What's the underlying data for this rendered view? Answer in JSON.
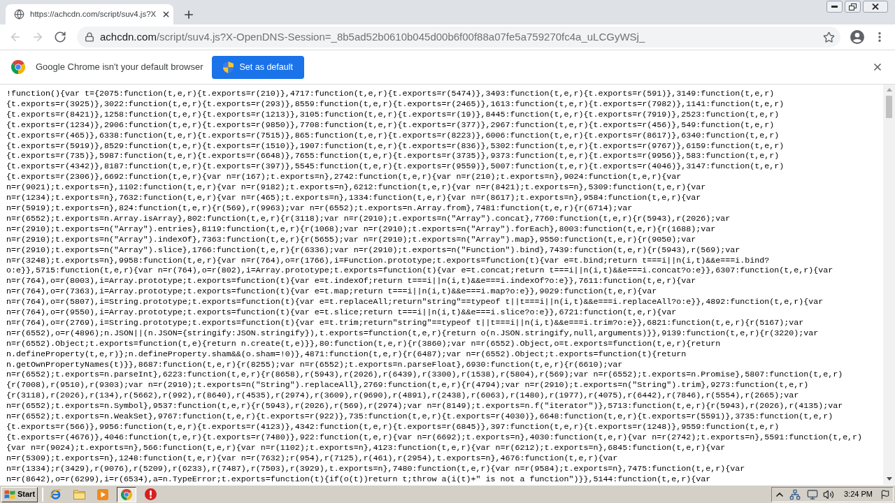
{
  "tabs": [
    {
      "title": "https://achcdn.com/script/suv4.js?X",
      "selected": true
    }
  ],
  "toolbar": {
    "nav": [
      {
        "kind": "back",
        "disabled": true
      },
      {
        "kind": "forward",
        "disabled": true
      },
      {
        "kind": "reload",
        "disabled": false
      }
    ],
    "url_host": "achcdn.com",
    "url_path": "/script/suv4.js?X-OpenDNS-Session=_8b5ad52b0610b045d00b6f00f88a07fe5a759270fc4a_uLCGyWSj_"
  },
  "infobar": {
    "message": "Google Chrome isn't your default browser",
    "button": "Set as default"
  },
  "document": {
    "lines": [
      "!function(){var t={2075:function(t,e,r){t.exports=r(210)},4717:function(t,e,r){t.exports=r(5474)},3493:function(t,e,r){t.exports=r(591)},3149:function(t,e,r)",
      "{t.exports=r(3925)},3022:function(t,e,r){t.exports=r(293)},8559:function(t,e,r){t.exports=r(2465)},1613:function(t,e,r){t.exports=r(7982)},1141:function(t,e,r)",
      "{t.exports=r(8421)},1258:function(t,e,r){t.exports=r(1213)},3105:function(t,e,r){t.exports=r(19)},8445:function(t,e,r){t.exports=r(7919)},2523:function(t,e,r)",
      "{t.exports=r(1234)},2906:function(t,e,r){t.exports=r(9850)},7708:function(t,e,r){t.exports=r(377)},2967:function(t,e,r){t.exports=r(456)},549:function(t,e,r)",
      "{t.exports=r(465)},6338:function(t,e,r){t.exports=r(7515)},865:function(t,e,r){t.exports=r(8223)},6006:function(t,e,r){t.exports=r(8617)},6340:function(t,e,r)",
      "{t.exports=r(5919)},8529:function(t,e,r){t.exports=r(1510)},1907:function(t,e,r){t.exports=r(836)},5302:function(t,e,r){t.exports=r(9767)},6159:function(t,e,r)",
      "{t.exports=r(735)},5987:function(t,e,r){t.exports=r(6648)},7655:function(t,e,r){t.exports=r(3735)},9373:function(t,e,r){t.exports=r(9956)},583:function(t,e,r)",
      "{t.exports=r(4342)},8187:function(t,e,r){t.exports=r(397)},5545:function(t,e,r){t.exports=r(9559)},5007:function(t,e,r){t.exports=r(4046)},3147:function(t,e,r)",
      "{t.exports=r(2306)},6692:function(t,e,r){var n=r(167);t.exports=n},2742:function(t,e,r){var n=r(210);t.exports=n},9024:function(t,e,r){var",
      "n=r(9021);t.exports=n},1102:function(t,e,r){var n=r(9182);t.exports=n},6212:function(t,e,r){var n=r(8421);t.exports=n},5309:function(t,e,r){var",
      "n=r(1234);t.exports=n},7632:function(t,e,r){var n=r(465);t.exports=n},1334:function(t,e,r){var n=r(8617);t.exports=n},9584:function(t,e,r){var",
      "n=r(5919);t.exports=n},824:function(t,e,r){r(569),r(9963);var n=r(6552);t.exports=n.Array.from},7481:function(t,e,r){r(6714);var",
      "n=r(6552);t.exports=n.Array.isArray},802:function(t,e,r){r(3118);var n=r(2910);t.exports=n(\"Array\").concat},7760:function(t,e,r){r(5943),r(2026);var",
      "n=r(2910);t.exports=n(\"Array\").entries},8119:function(t,e,r){r(1068);var n=r(2910);t.exports=n(\"Array\").forEach},8003:function(t,e,r){r(1688);var",
      "n=r(2910);t.exports=n(\"Array\").indexOf},7363:function(t,e,r){r(5655);var n=r(2910);t.exports=n(\"Array\").map},9550:function(t,e,r){r(9050);var",
      "n=r(2910);t.exports=n(\"Array\").slice},1766:function(t,e,r){r(6336);var n=r(2910);t.exports=n(\"Function\").bind},7439:function(t,e,r){r(5943),r(569);var",
      "n=r(3248);t.exports=n},9958:function(t,e,r){var n=r(764),o=r(1766),i=Function.prototype;t.exports=function(t){var e=t.bind;return t===i||n(i,t)&&e===i.bind?",
      "o:e}},5715:function(t,e,r){var n=r(764),o=r(802),i=Array.prototype;t.exports=function(t){var e=t.concat;return t===i||n(i,t)&&e===i.concat?o:e}},6307:function(t,e,r){var",
      "n=r(764),o=r(8003),i=Array.prototype;t.exports=function(t){var e=t.indexOf;return t===i||n(i,t)&&e===i.indexOf?o:e}},7611:function(t,e,r){var",
      "n=r(764),o=r(7363),i=Array.prototype;t.exports=function(t){var e=t.map;return t===i||n(i,t)&&e===i.map?o:e}},9029:function(t,e,r){var",
      "n=r(764),o=r(5807),i=String.prototype;t.exports=function(t){var e=t.replaceAll;return\"string\"==typeof t||t===i||n(i,t)&&e===i.replaceAll?o:e}},4892:function(t,e,r){var",
      "n=r(764),o=r(9550),i=Array.prototype;t.exports=function(t){var e=t.slice;return t===i||n(i,t)&&e===i.slice?o:e}},6721:function(t,e,r){var",
      "n=r(764),o=r(2769),i=String.prototype;t.exports=function(t){var e=t.trim;return\"string\"==typeof t||t===i||n(i,t)&&e===i.trim?o:e}},6821:function(t,e,r){r(5167);var",
      "n=r(6552),o=r(4896);n.JSON||(n.JSON={stringify:JSON.stringify}),t.exports=function(t,e,r){return o(n.JSON.stringify,null,arguments)}},9139:function(t,e,r){r(3220);var",
      "n=r(6552).Object;t.exports=function(t,e){return n.create(t,e)}},80:function(t,e,r){r(3860);var n=r(6552).Object,o=t.exports=function(t,e,r){return",
      "n.defineProperty(t,e,r)};n.defineProperty.sham&&(o.sham=!0)},4871:function(t,e,r){r(6487);var n=r(6552).Object;t.exports=function(t){return",
      "n.getOwnPropertyNames(t)}},8687:function(t,e,r){r(8255);var n=r(6552);t.exports=n.parseFloat},6930:function(t,e,r){r(6610);var",
      "n=r(6552);t.exports=n.parseInt},6223:function(t,e,r){r(8658),r(5943),r(2026),r(6439),r(3300),r(1538),r(5804),r(569);var n=r(6552);t.exports=n.Promise},5807:function(t,e,r)",
      "{r(7008),r(9510),r(9303);var n=r(2910);t.exports=n(\"String\").replaceAll},2769:function(t,e,r){r(4794);var n=r(2910);t.exports=n(\"String\").trim},9273:function(t,e,r)",
      "{r(3118),r(2026),r(134),r(5662),r(992),r(8640),r(4535),r(2974),r(3609),r(9690),r(4891),r(2438),r(6063),r(1480),r(1977),r(4075),r(6442),r(7846),r(5554),r(2665);var",
      "n=r(6552);t.exports=n.Symbol},9537:function(t,e,r){r(5943),r(2026),r(569),r(2974);var n=r(8149);t.exports=n.f(\"iterator\")},5713:function(t,e,r){r(5943),r(2026),r(4135);var",
      "n=r(6552);t.exports=n.WeakSet},9767:function(t,e,r){t.exports=r(922)},735:function(t,e,r){t.exports=r(4030)},6648:function(t,e,r){t.exports=r(5591)},3735:function(t,e,r)",
      "{t.exports=r(566)},9956:function(t,e,r){t.exports=r(4123)},4342:function(t,e,r){t.exports=r(6845)},397:function(t,e,r){t.exports=r(1248)},9559:function(t,e,r)",
      "{t.exports=r(4676)},4046:function(t,e,r){t.exports=r(7480)},922:function(t,e,r){var n=r(6692);t.exports=n},4030:function(t,e,r){var n=r(2742);t.exports=n},5591:function(t,e,r)",
      "{var n=r(9024);t.exports=n},566:function(t,e,r){var n=r(1102);t.exports=n},4123:function(t,e,r){var n=r(6212);t.exports=n},6845:function(t,e,r){var",
      "n=r(5309);t.exports=n},1248:function(t,e,r){var n=r(7632);r(954),r(7125),r(461),r(2954),t.exports=n},4676:function(t,e,r){var",
      "n=r(1334);r(3429),r(9076),r(5209),r(6233),r(7487),r(7503),r(3929),t.exports=n},7480:function(t,e,r){var n=r(9584);t.exports=n},7475:function(t,e,r){var",
      "n=r(8642),o=r(6299),i=r(6534),a=n.TypeError;t.exports=function(t){if(o(t))return t;throw a(i(t)+\" is not a function\")}},5144:function(t,e,r){var"
    ]
  },
  "taskbar": {
    "start": "Start",
    "apps": [
      {
        "kind": "ie",
        "selected": false
      },
      {
        "kind": "folder",
        "selected": false
      },
      {
        "kind": "media",
        "selected": false
      },
      {
        "kind": "chrome",
        "selected": true
      },
      {
        "kind": "stop",
        "selected": false
      }
    ],
    "clock": "3:24 PM"
  }
}
